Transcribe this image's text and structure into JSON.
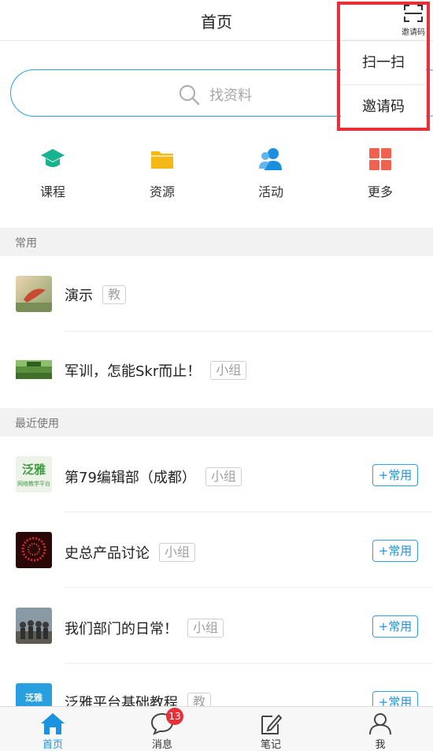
{
  "header": {
    "title": "首页",
    "scan_label": "邀请码"
  },
  "search": {
    "placeholder": "找资料"
  },
  "quick_links": [
    {
      "label": "课程",
      "icon": "graduation-cap-icon",
      "color": "#19b38f"
    },
    {
      "label": "资源",
      "icon": "folder-icon",
      "color": "#f5b915"
    },
    {
      "label": "活动",
      "icon": "people-icon",
      "color": "#1a8fe0"
    },
    {
      "label": "更多",
      "icon": "grid-icon",
      "color": "#f2604f"
    }
  ],
  "sections": {
    "frequent": "常用",
    "recent": "最近使用"
  },
  "frequent_items": [
    {
      "name": "演示",
      "tag": "教"
    },
    {
      "name": "军训，怎能Skr而止！",
      "tag": "小组"
    }
  ],
  "recent_items": [
    {
      "name": "第79编辑部（成都）",
      "tag": "小组",
      "action": "+常用"
    },
    {
      "name": "史总产品讨论",
      "tag": "小组",
      "action": "+常用"
    },
    {
      "name": "我们部门的日常！",
      "tag": "小组",
      "action": "+常用"
    },
    {
      "name": "泛雅平台基础教程",
      "tag": "教",
      "action": "+常用"
    }
  ],
  "thumb_texts": {
    "group1_big": "泛雅",
    "group1_small": "网络教学平台",
    "course": "泛雅"
  },
  "dropdown": {
    "items": [
      "扫一扫",
      "邀请码"
    ]
  },
  "tabbar": {
    "tabs": [
      {
        "label": "首页",
        "icon": "home-icon"
      },
      {
        "label": "消息",
        "icon": "message-icon"
      },
      {
        "label": "笔记",
        "icon": "note-icon"
      },
      {
        "label": "我",
        "icon": "person-icon"
      }
    ],
    "message_badge": "13"
  },
  "colors": {
    "accent": "#1a94e0",
    "highlight_frame": "#e8303a"
  }
}
